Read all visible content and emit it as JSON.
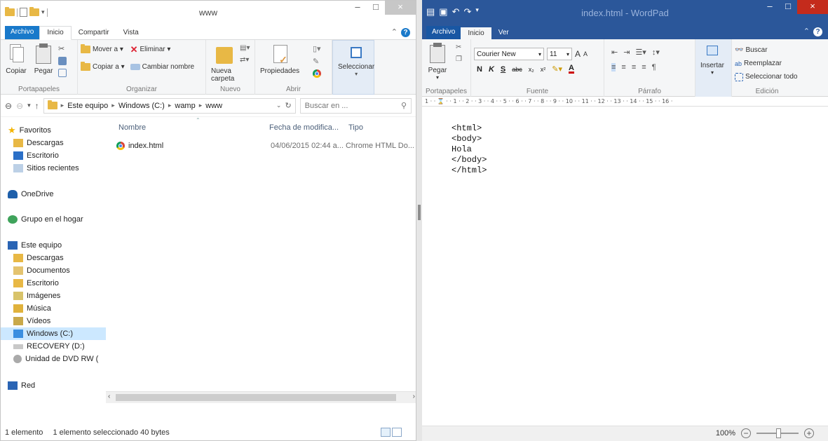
{
  "explorer": {
    "title": "www",
    "tabs": [
      "Archivo",
      "Inicio",
      "Compartir",
      "Vista"
    ],
    "ribbon": {
      "portapapeles": {
        "copiar": "Copiar",
        "pegar": "Pegar",
        "label": "Portapapeles"
      },
      "organizar": {
        "mover": "Mover a ▾",
        "copiar_a": "Copiar a ▾",
        "eliminar": "Eliminar ▾",
        "cambiar_nombre": "Cambiar nombre",
        "label": "Organizar"
      },
      "nuevo": {
        "nueva_carpeta": "Nueva carpeta",
        "label": "Nuevo"
      },
      "abrir": {
        "propiedades": "Propiedades",
        "label": "Abrir"
      },
      "seleccionar": {
        "label": "Seleccionar"
      }
    },
    "address": {
      "crumbs": [
        "Este equipo",
        "Windows (C:)",
        "wamp",
        "www"
      ],
      "search_placeholder": "Buscar en ..."
    },
    "nav": {
      "favoritos": "Favoritos",
      "descargas": "Descargas",
      "escritorio": "Escritorio",
      "sitios": "Sitios recientes",
      "onedrive": "OneDrive",
      "grupo": "Grupo en el hogar",
      "equipo": "Este equipo",
      "eq_descargas": "Descargas",
      "documentos": "Documentos",
      "eq_escritorio": "Escritorio",
      "imagenes": "Imágenes",
      "musica": "Música",
      "videos": "Vídeos",
      "windows": "Windows (C:)",
      "recovery": "RECOVERY (D:)",
      "dvd": "Unidad de DVD RW (",
      "red": "Red"
    },
    "columns": {
      "nombre": "Nombre",
      "fecha": "Fecha de modifica...",
      "tipo": "Tipo"
    },
    "files": [
      {
        "name": "index.html",
        "date": "04/06/2015 02:44 a...",
        "type": "Chrome HTML Do..."
      }
    ],
    "status": {
      "count": "1 elemento",
      "selected": "1 elemento seleccionado  40 bytes"
    }
  },
  "wordpad": {
    "title": "index.html - WordPad",
    "tabs": [
      "Archivo",
      "Inicio",
      "Ver"
    ],
    "ribbon": {
      "pegar": "Pegar",
      "portapapeles": "Portapapeles",
      "font": "Courier New",
      "size": "11",
      "fuente": "Fuente",
      "parrafo": "Párrafo",
      "insertar": "Insertar",
      "buscar": "Buscar",
      "reemplazar": "Reemplazar",
      "seleccionar_todo": "Seleccionar todo",
      "edicion": "Edición"
    },
    "ruler": "1 · · ⌛ · · 1 · · 2 · · 3 · · 4 · · 5 · · 6 · · 7 · · 8 · · 9 · · 10 · · 11 · · 12 · · 13 · · 14 · · 15 · · 16 ·",
    "content": [
      "<html>",
      "<body>",
      "Hola",
      "</body>",
      "</html>"
    ],
    "zoom": "100%"
  },
  "colors": {
    "explorer_accent": "#1979ca",
    "wordpad_accent": "#2b579a",
    "selection": "#cce8ff"
  }
}
